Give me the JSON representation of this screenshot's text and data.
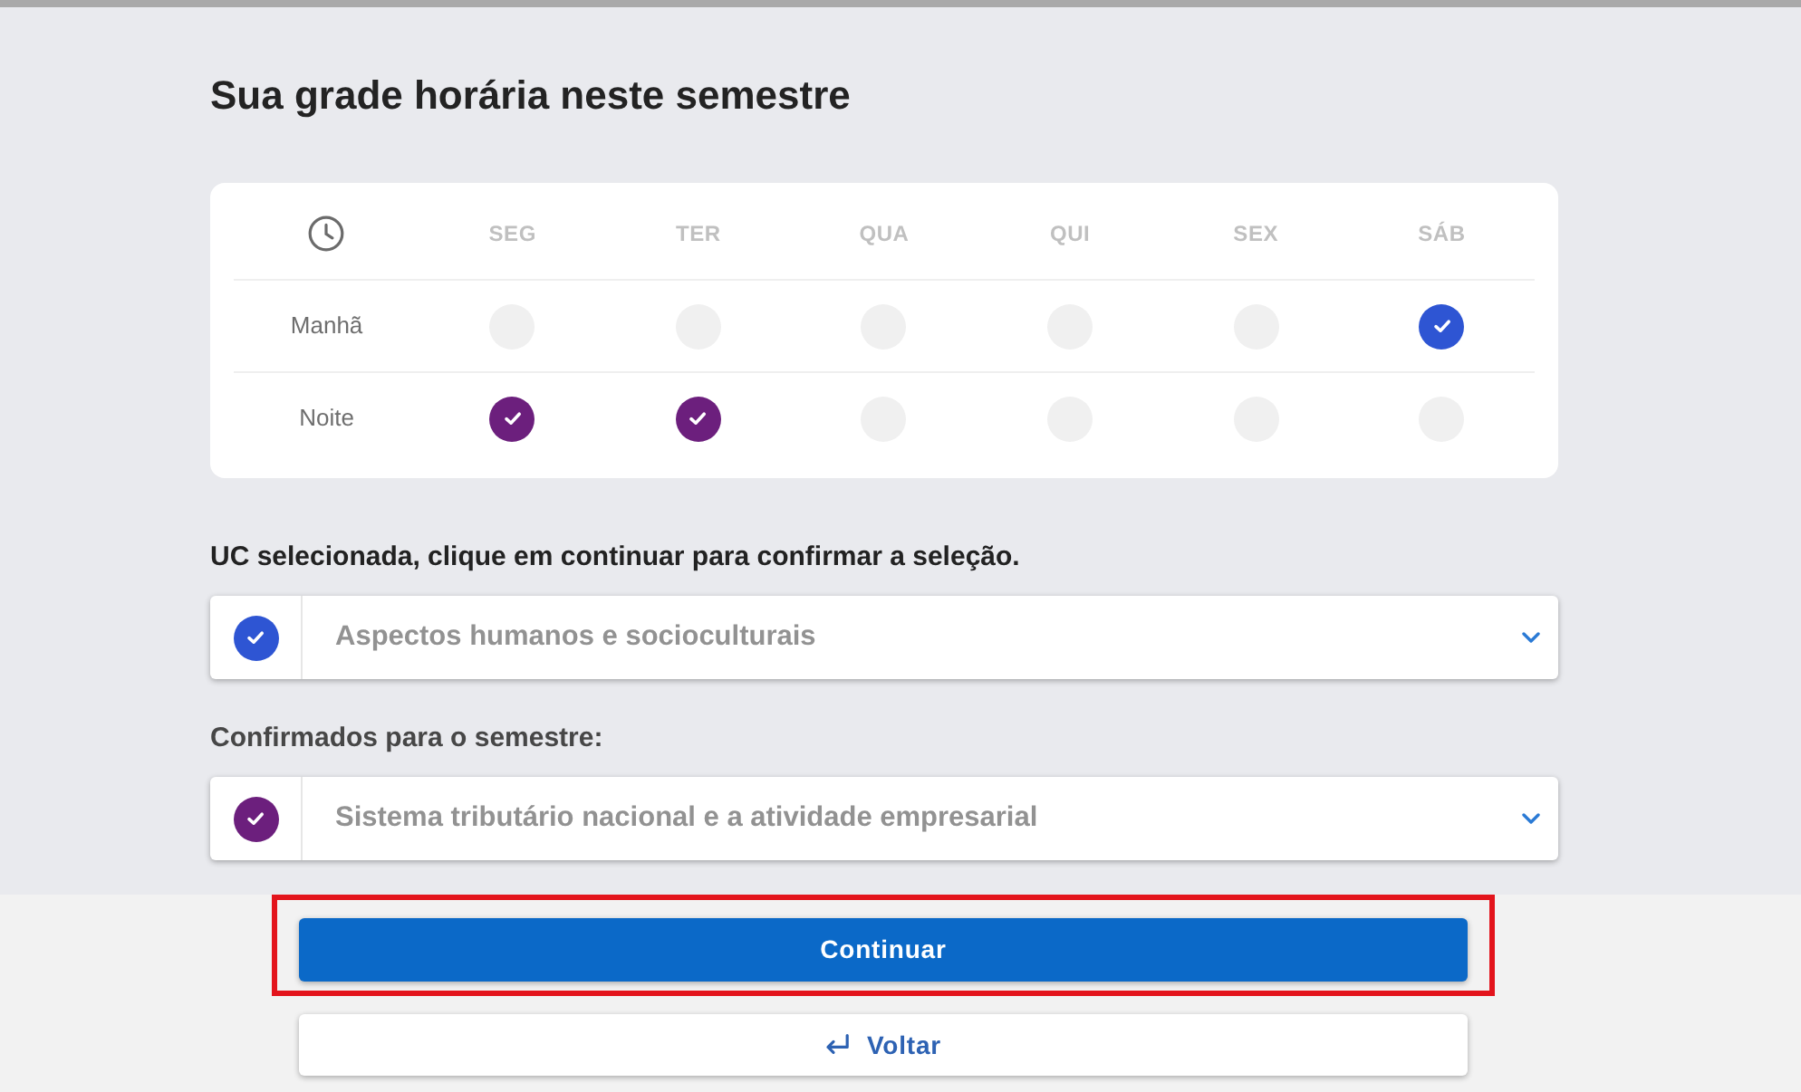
{
  "title": "Sua grade horária neste semestre",
  "schedule": {
    "days": [
      "SEG",
      "TER",
      "QUA",
      "QUI",
      "SEX",
      "SÁB"
    ],
    "periods": [
      {
        "label": "Manhã",
        "slots": [
          {
            "checked": false
          },
          {
            "checked": false
          },
          {
            "checked": false
          },
          {
            "checked": false
          },
          {
            "checked": false
          },
          {
            "checked": true,
            "color": "#2e55d3"
          }
        ]
      },
      {
        "label": "Noite",
        "slots": [
          {
            "checked": true,
            "color": "#6c1f7d"
          },
          {
            "checked": true,
            "color": "#6c1f7d"
          },
          {
            "checked": false
          },
          {
            "checked": false
          },
          {
            "checked": false
          },
          {
            "checked": false
          }
        ]
      }
    ]
  },
  "sections": [
    {
      "kind": "instruction",
      "heading": "UC selecionada, clique em continuar para confirmar a seleção.",
      "dropdown": {
        "value": "Aspectos humanos e socioculturais",
        "color": "#2e55d3"
      }
    },
    {
      "kind": "confirmed",
      "heading": "Confirmados para o semestre:",
      "dropdown": {
        "value": "Sistema tributário nacional e a atividade empresarial",
        "color": "#6c1f7d"
      }
    }
  ],
  "buttons": [
    {
      "kind": "primary",
      "label": "Continuar",
      "highlighted": true
    },
    {
      "kind": "back",
      "label": "Voltar",
      "highlighted": false
    }
  ]
}
